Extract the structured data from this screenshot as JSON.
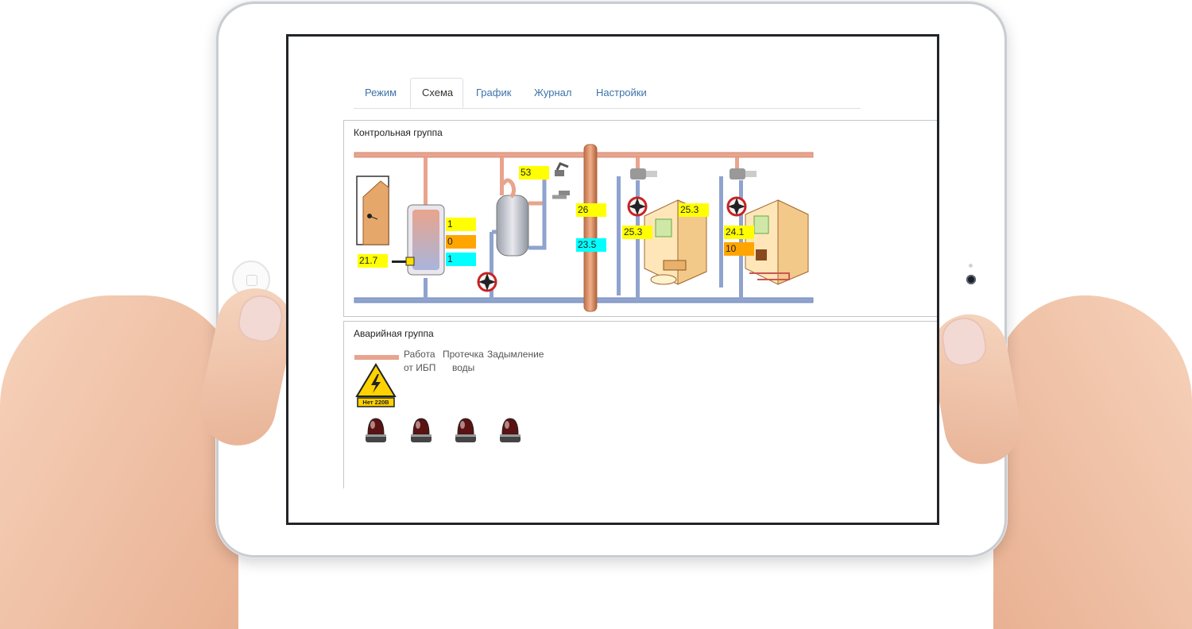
{
  "tabs": [
    {
      "label": "Режим",
      "active": false
    },
    {
      "label": "Схема",
      "active": true
    },
    {
      "label": "График",
      "active": false
    },
    {
      "label": "Журнал",
      "active": false
    },
    {
      "label": "Настройки",
      "active": false
    }
  ],
  "control_group": {
    "title": "Контрольная группа",
    "outdoor_temp": "21.7",
    "boiler_status": [
      "1",
      "0",
      "1"
    ],
    "water_heater_temp": "53",
    "manifold_top_temp": "26",
    "manifold_bottom_temp": "23.5",
    "room1_air_temp": "25.3",
    "room1_supply_temp": "25.3",
    "room2_supply_temp": "24.1",
    "room2_setting": "10"
  },
  "emergency_group": {
    "title": "Аварийная группа",
    "labels": [
      {
        "line1": "Работа",
        "line2": "от ИБП"
      },
      {
        "line1": "Протечка",
        "line2": "воды"
      },
      {
        "line1": "Задымление",
        "line2": ""
      }
    ],
    "power_sign_text": "Нет 220В"
  },
  "colors": {
    "supply_pipe": "#e8a48c",
    "return_pipe": "#8fa3cf",
    "tab_link": "#3d73a8",
    "value_yellow": "#ffff00",
    "value_orange": "#ffa500",
    "value_cyan": "#00ffff"
  }
}
